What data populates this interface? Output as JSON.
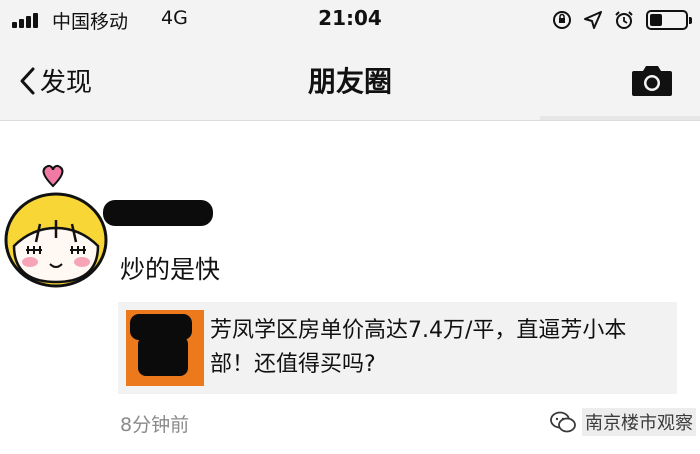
{
  "status_bar": {
    "carrier": "中国移动",
    "network": "4G",
    "time": "21:04",
    "icons": [
      "rotation-lock-icon",
      "location-arrow-icon",
      "alarm-icon",
      "battery-icon"
    ]
  },
  "nav": {
    "back_label": "发现",
    "title": "朋友圈",
    "camera_icon": "camera-icon"
  },
  "post": {
    "text": "炒的是快",
    "shared_link": {
      "title": "芳凤学区房单价高达7.4万/平，直逼芳小本部！还值得买吗?"
    },
    "timestamp": "8分钟前"
  },
  "watermark": {
    "text": "南京楼市观察",
    "icon": "wechat-official-account-icon"
  },
  "colors": {
    "bar_bg": "#f3f3f3",
    "card_bg": "#f2f2f2",
    "thumb_orange": "#ec7a1c",
    "timestamp_gray": "#8a8a8a"
  }
}
